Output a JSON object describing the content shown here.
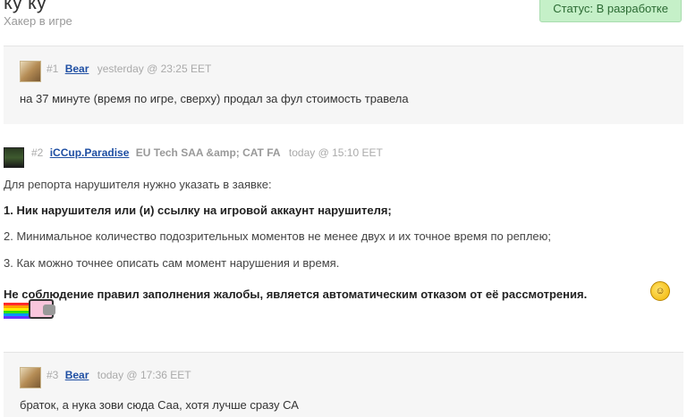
{
  "topic": {
    "title": "ку ку",
    "subtitle": "Хакер в игре",
    "status": "Статус: В разработке"
  },
  "replies": [
    {
      "num": "#1",
      "user": "Bear",
      "time": "yesterday @ 23:25 EET",
      "body": "на 37 минуте (время по игре, сверху) продал за фул стоимость травела"
    },
    {
      "num": "#2",
      "user": "iCCup.Paradise",
      "clan": "EU Tech SAA &amp; CAT FA",
      "time": "today @ 15:10 EET",
      "lines": [
        "Для репорта нарушителя нужно указать в заявке:",
        "1. Ник нарушителя или (и) ссылку на игровой аккаунт нарушителя;",
        "2. Минимальное количество подозрительных моментов не менее двух и их точное время по реплею;",
        "3. Как можно точнее описать сам момент нарушения и время.",
        "Не соблюдение правил заполнения жалобы, является автоматическим отказом от её рассмотрения."
      ],
      "smiley_icon": "facepalm-smiley-icon",
      "sticker_icon": "nyan-cat-icon"
    },
    {
      "num": "#3",
      "user": "Bear",
      "time": "today @ 17:36 EET",
      "body": "браток, а нука зови сюда Саа, хотя лучше сразу СА"
    }
  ]
}
